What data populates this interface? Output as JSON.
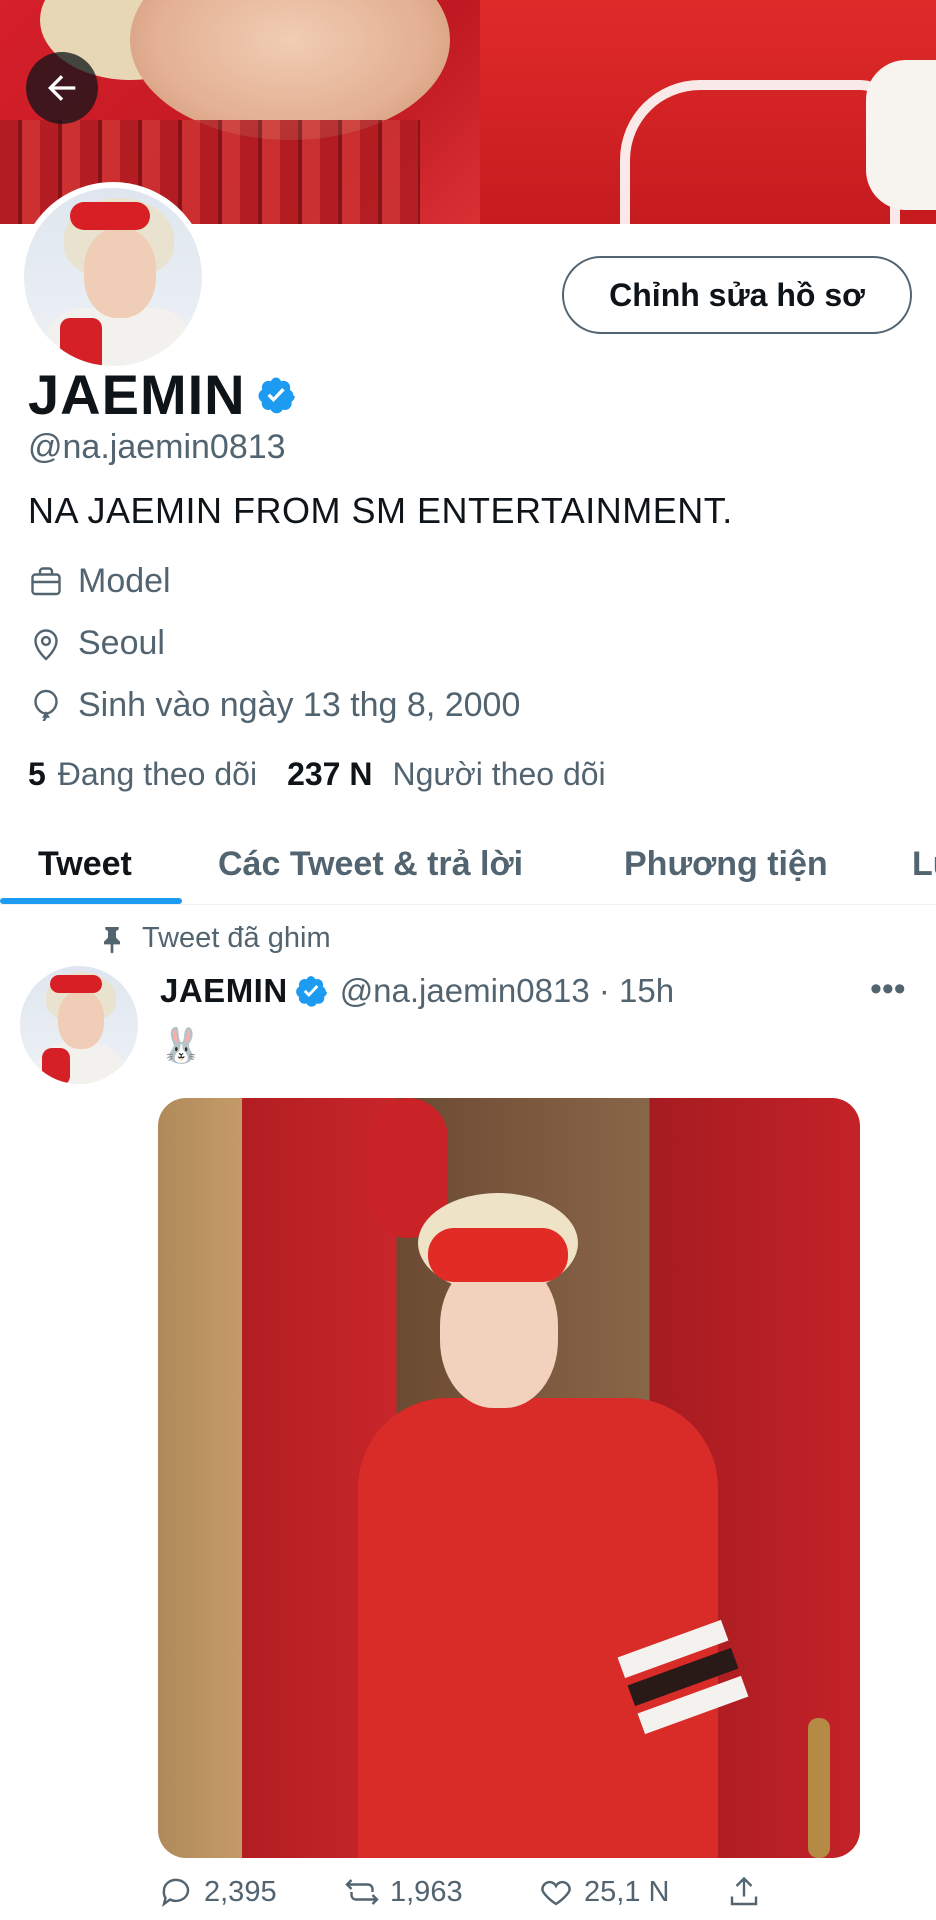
{
  "profile": {
    "name": "JAEMIN",
    "handle": "@na.jaemin0813",
    "bio": "NA JAEMIN FROM SM ENTERTAINMENT.",
    "edit_label": "Chỉnh sửa hồ sơ",
    "category": "Model",
    "location": "Seoul",
    "birthday": "Sinh vào ngày 13 thg 8, 2000",
    "following_count": "5",
    "following_label": "Đang theo dõi",
    "followers_count": "237 N",
    "followers_label": "Người theo dõi"
  },
  "tabs": [
    {
      "label": "Tweet",
      "active": true
    },
    {
      "label": "Các Tweet & trả lời",
      "active": false
    },
    {
      "label": "Phương tiện",
      "active": false
    },
    {
      "label": "Lư",
      "active": false
    }
  ],
  "tweet": {
    "pinned_label": "Tweet đã ghim",
    "author": "JAEMIN",
    "handle_time": "@na.jaemin0813 · 15h",
    "text": "🐰",
    "more": "•••",
    "replies": "2,395",
    "retweets": "1,963",
    "likes": "25,1 N"
  },
  "colors": {
    "accent": "#1d9bf0",
    "text": "#0f1419",
    "muted": "#536471"
  }
}
